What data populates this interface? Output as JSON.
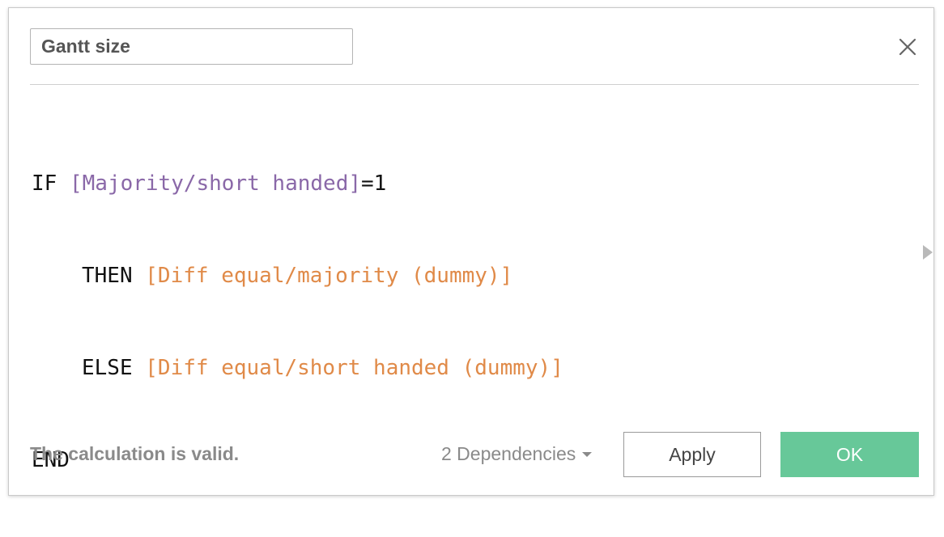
{
  "dialog": {
    "calc_name": "Gantt size",
    "close_icon": "close-icon",
    "expand_icon": "chevron-right-icon"
  },
  "formula": {
    "line1": {
      "kw_if": "IF",
      "field": "[Majority/short handed]",
      "rest": "=1"
    },
    "line2": {
      "kw_then": "THEN",
      "field": "[Diff equal/majority (dummy)]"
    },
    "line3": {
      "kw_else": "ELSE",
      "field": "[Diff equal/short handed (dummy)]"
    },
    "line4": {
      "kw_end": "END"
    }
  },
  "footer": {
    "status": "The calculation is valid.",
    "dependencies": "2 Dependencies",
    "apply_label": "Apply",
    "ok_label": "OK"
  },
  "colors": {
    "field_purple": "#8a68a8",
    "field_orange": "#e08a48",
    "ok_green": "#67c899"
  }
}
